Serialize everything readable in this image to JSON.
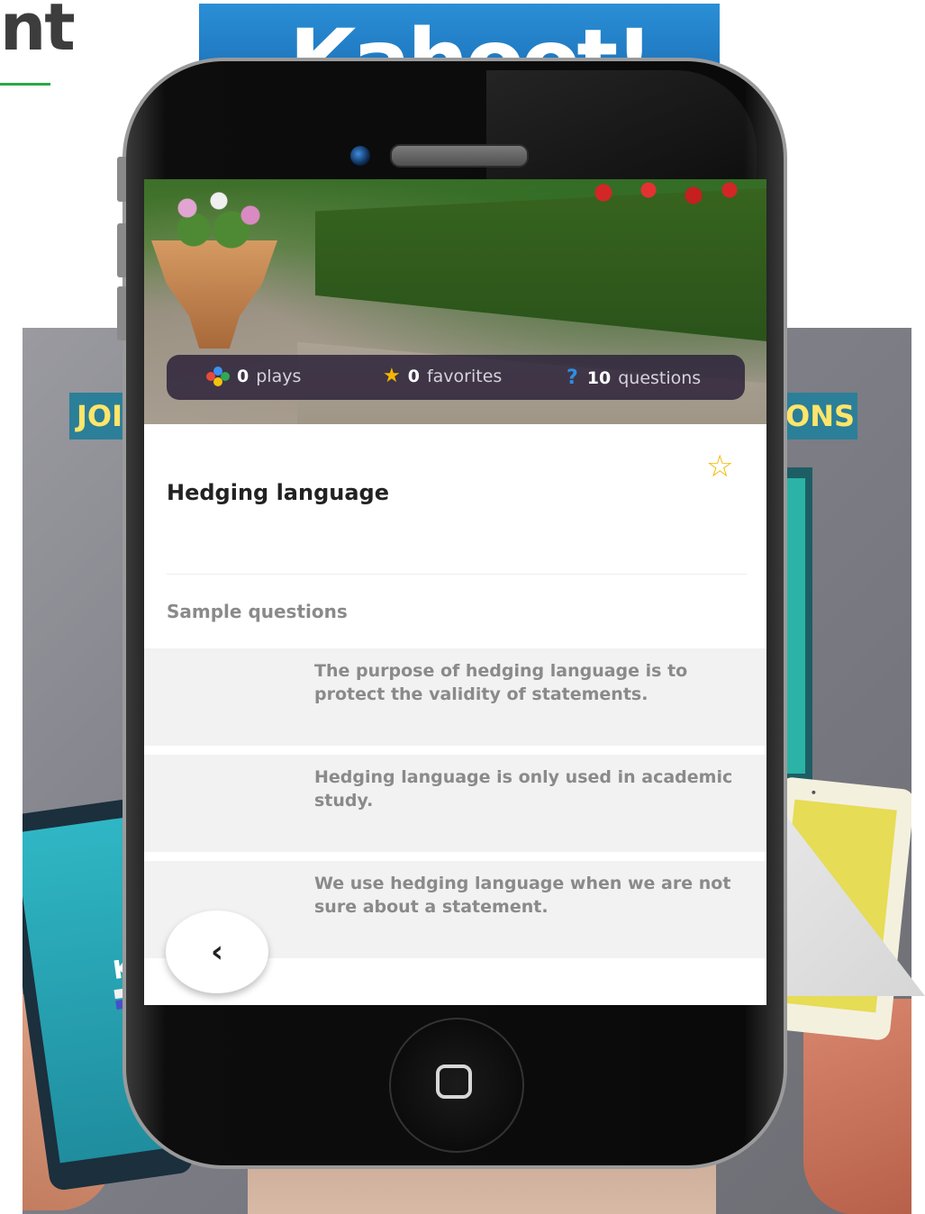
{
  "page": {
    "heading_fragment": "nt",
    "banner_text": "Kahoot!",
    "bg_sign_left": "JOI",
    "bg_sign_right": "ONS",
    "tablet_letter": "K"
  },
  "quiz": {
    "stats": {
      "plays_count": "0",
      "plays_label": "plays",
      "favorites_count": "0",
      "favorites_label": "favorites",
      "questions_count": "10",
      "questions_label": "questions"
    },
    "title": "Hedging language",
    "section_title": "Sample questions",
    "questions": [
      {
        "text": "The purpose of hedging language is to protect the validity of statements."
      },
      {
        "text": "Hedging language is only used in academic study."
      },
      {
        "text": "We use hedging language when we are not sure about a statement."
      }
    ],
    "back_label": "‹"
  },
  "icons": {
    "stats_plays": "dots-icon",
    "stats_favorites": "star-icon",
    "stats_questions": "question-mark-icon",
    "favorite_toggle": "star-outline-icon",
    "back": "chevron-left-icon"
  },
  "colors": {
    "star": "#f5b800",
    "question_mark": "#2f8de4",
    "heading_underline": "#2aa845",
    "stats_bar_bg": "#281e37"
  }
}
